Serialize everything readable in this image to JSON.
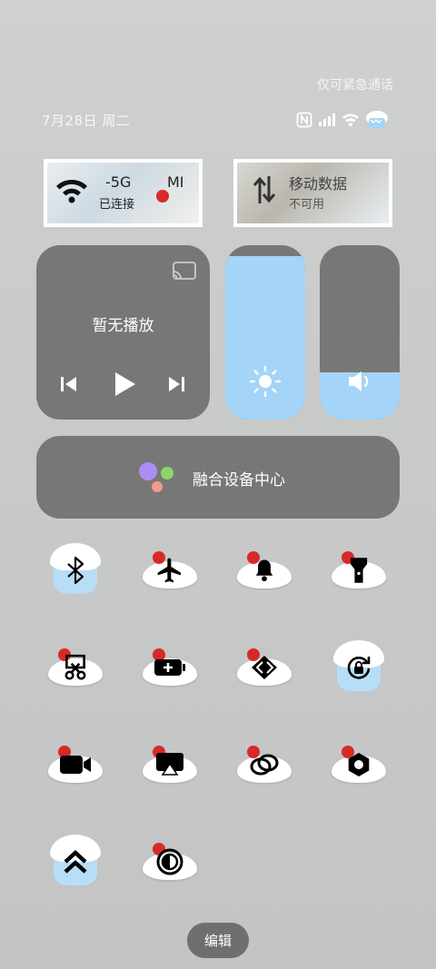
{
  "emergency_text": "仅可紧急通话",
  "date_text": "7月28日 周二",
  "wifi_tile": {
    "title": "-5G",
    "title_suffix": "MI",
    "subtitle": "已连接"
  },
  "mobile_tile": {
    "title": "移动数据",
    "subtitle": "不可用"
  },
  "media": {
    "title": "暂无播放"
  },
  "brightness_level": 0.94,
  "volume_level": 0.27,
  "hub": {
    "label": "融合设备中心"
  },
  "toggles": [
    {
      "icon": "bluetooth-icon",
      "active": true
    },
    {
      "icon": "airplane-icon",
      "active": false
    },
    {
      "icon": "bell-icon",
      "active": false
    },
    {
      "icon": "flashlight-icon",
      "active": false
    },
    {
      "icon": "screenshot-icon",
      "active": false
    },
    {
      "icon": "battery-saver-icon",
      "active": false
    },
    {
      "icon": "dash-icon",
      "active": false
    },
    {
      "icon": "rotation-lock-icon",
      "active": true
    },
    {
      "icon": "video-icon",
      "active": false
    },
    {
      "icon": "cast-icon",
      "active": false
    },
    {
      "icon": "link-icon",
      "active": false
    },
    {
      "icon": "nut-icon",
      "active": false
    },
    {
      "icon": "performance-icon",
      "active": true
    },
    {
      "icon": "contrast-icon",
      "active": false
    }
  ],
  "edit_label": "编辑",
  "colors": {
    "accent": "#a4d4f7",
    "panel": "#777876",
    "cherry": "#d62a2a"
  }
}
